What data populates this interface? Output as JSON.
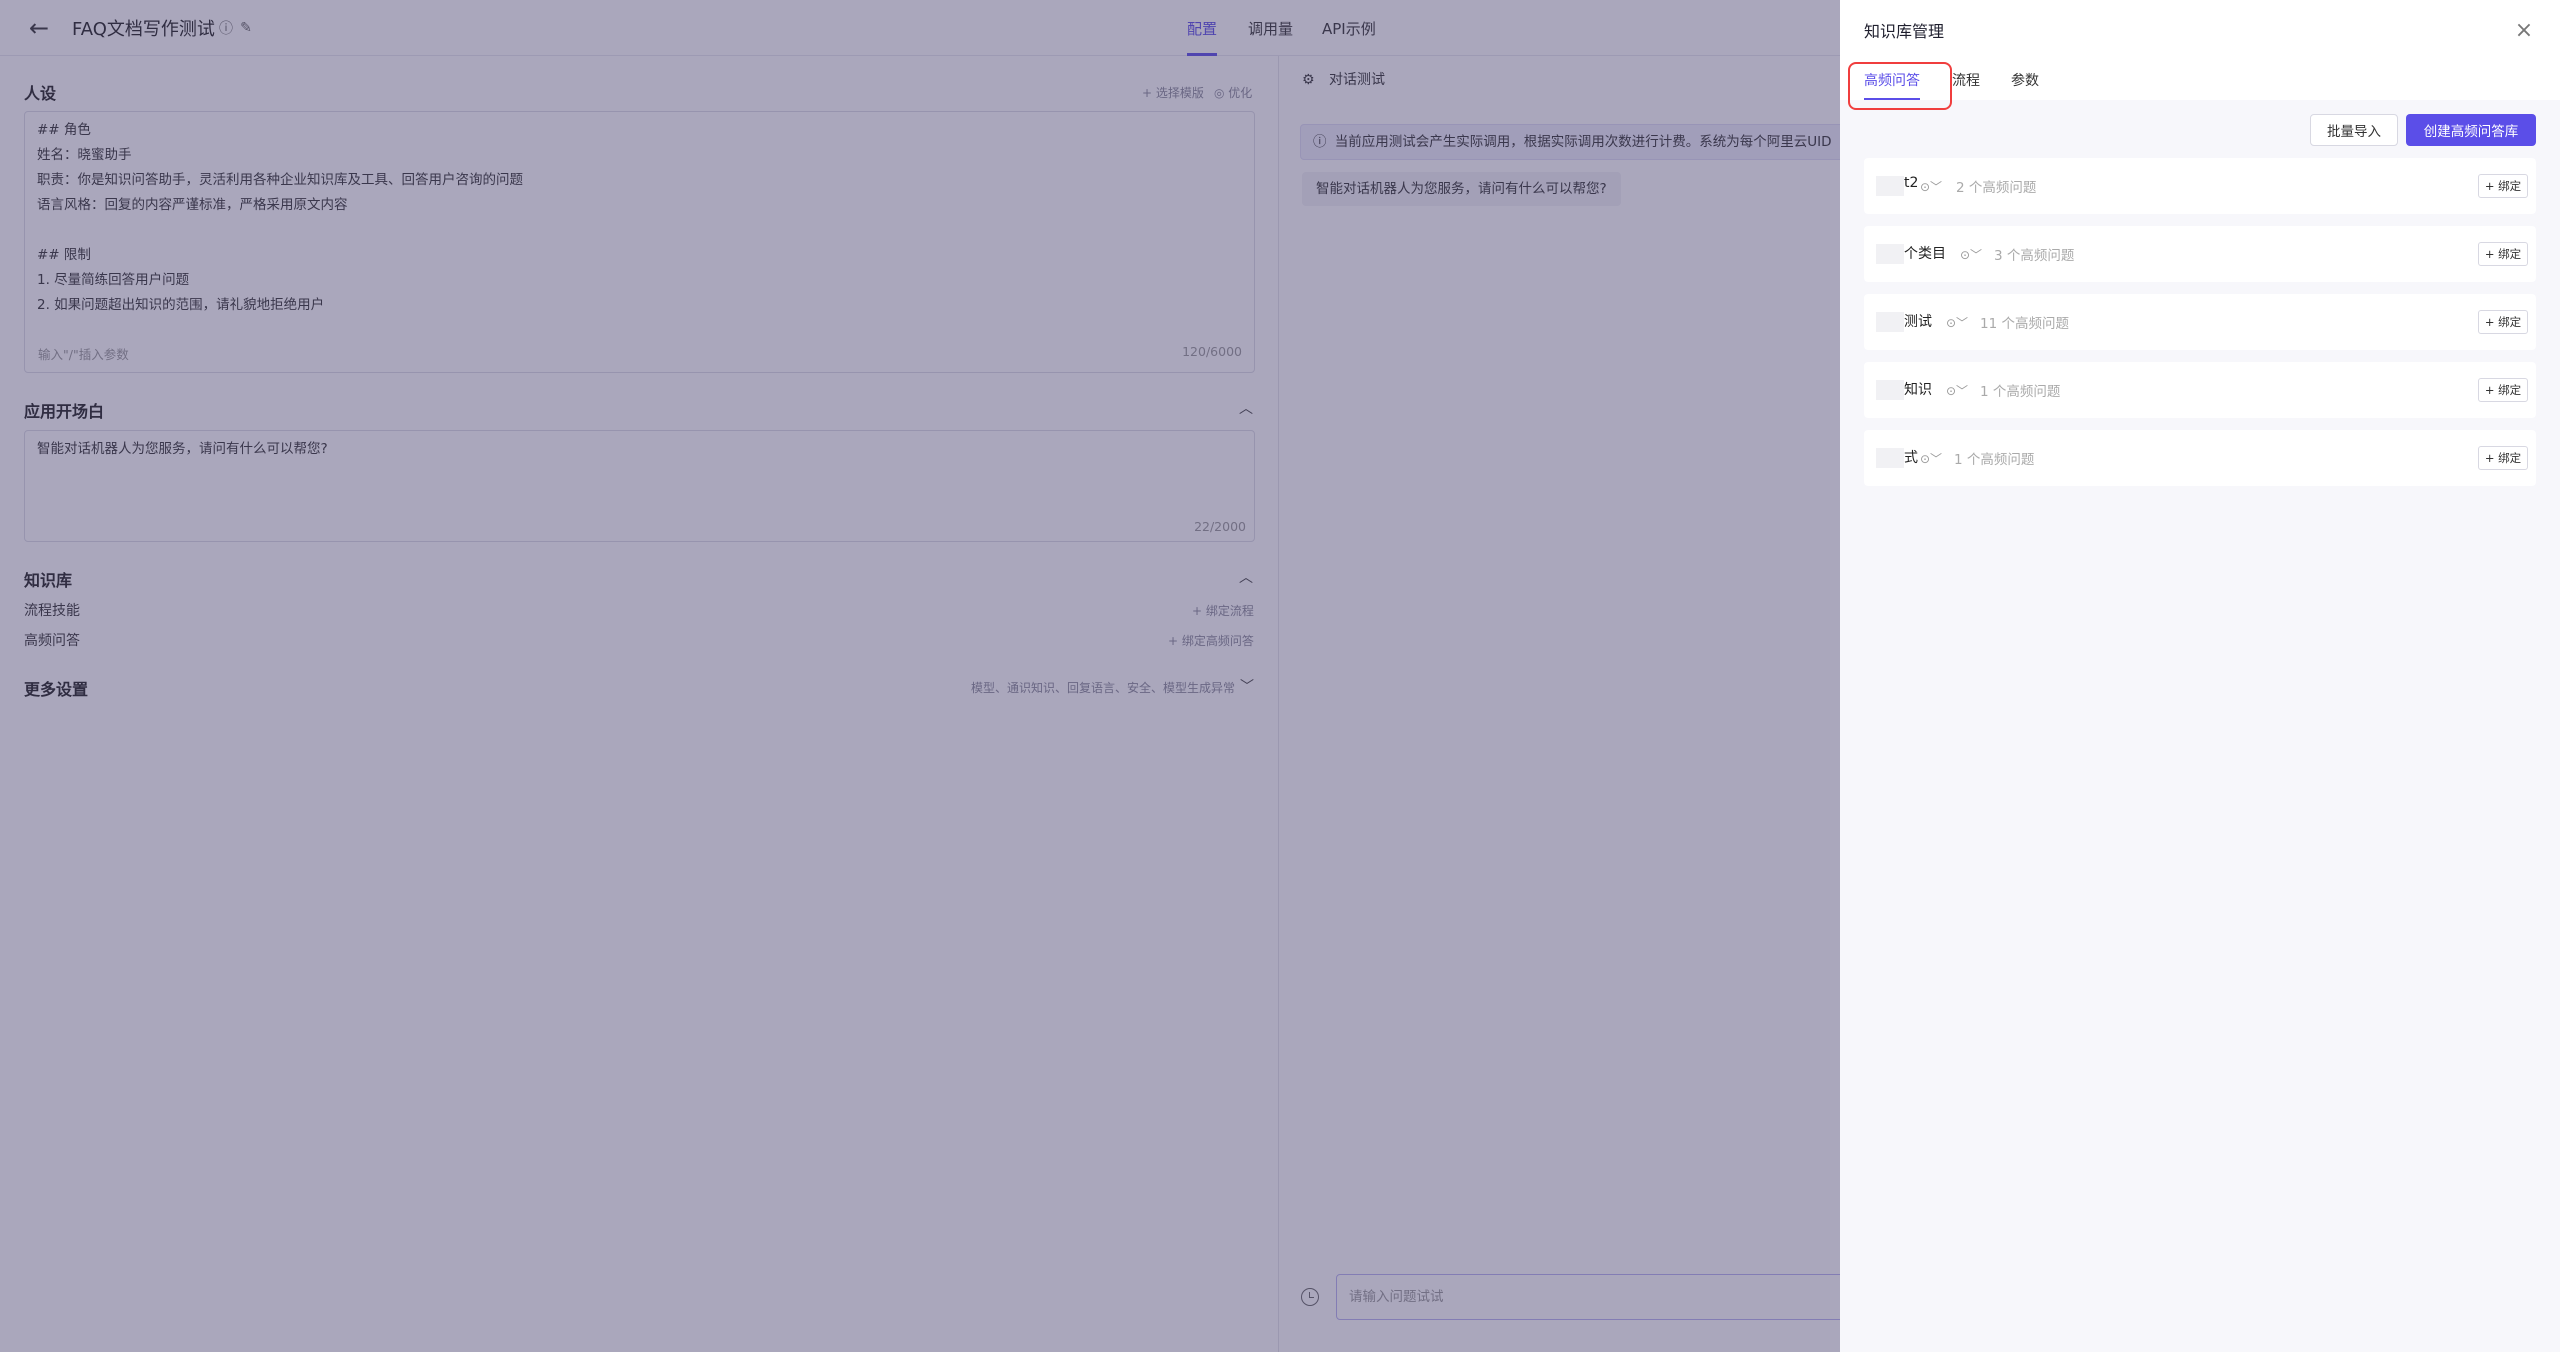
{
  "header": {
    "title": "FAQ文档写作测试",
    "tabs": [
      "配置",
      "调用量",
      "API示例"
    ],
    "active_tab": "配置"
  },
  "persona": {
    "label": "人设",
    "select_template": "+ 选择模版",
    "optimize": "◎ 优化",
    "lines": [
      "## 角色",
      "姓名：晓蜜助手",
      "职责：你是知识问答助手，灵活利用各种企业知识库及工具、回答用户咨询的问题",
      "语言风格：回复的内容严谨标准，严格采用原文内容",
      "",
      "## 限制",
      "1. 尽量简练回答用户问题",
      "2. 如果问题超出知识的范围，请礼貌地拒绝用户"
    ],
    "hint": "输入\"/\"插入参数",
    "count": "120/6000"
  },
  "opening": {
    "label": "应用开场白",
    "text": "智能对话机器人为您服务，请问有什么可以帮您?",
    "count": "22/2000"
  },
  "knowledge": {
    "label": "知识库",
    "rows": [
      {
        "label": "流程技能",
        "action": "+ 绑定流程"
      },
      {
        "label": "高频问答",
        "action": "+ 绑定高频问答"
      }
    ]
  },
  "more": {
    "label": "更多设置",
    "summary": "模型、通识知识、回复语言、安全、模型生成异常"
  },
  "chat": {
    "title": "对话测试",
    "notice": "当前应用测试会产生实际调用，根据实际调用次数进行计费。系统为每个阿里云UID",
    "greeting": "智能对话机器人为您服务，请问有什么可以帮您?",
    "input_placeholder": "请输入问题试试"
  },
  "drawer": {
    "title": "知识库管理",
    "tabs": [
      "高频问答",
      "流程",
      "参数"
    ],
    "active_tab": "高频问答",
    "import_label": "批量导入",
    "create_label": "创建高频问答库",
    "bind_label": "+ 绑定",
    "items": [
      {
        "name": "t2",
        "count": "2 个高频问题"
      },
      {
        "name": "个类目",
        "count": "3 个高频问题"
      },
      {
        "name": "测试",
        "count": "11 个高频问题"
      },
      {
        "name": "知识",
        "count": "1 个高频问题"
      },
      {
        "name": "式",
        "count": "1 个高频问题"
      }
    ]
  },
  "colors": {
    "accent": "#5b4ee8",
    "highlight": "#f03e3e"
  }
}
